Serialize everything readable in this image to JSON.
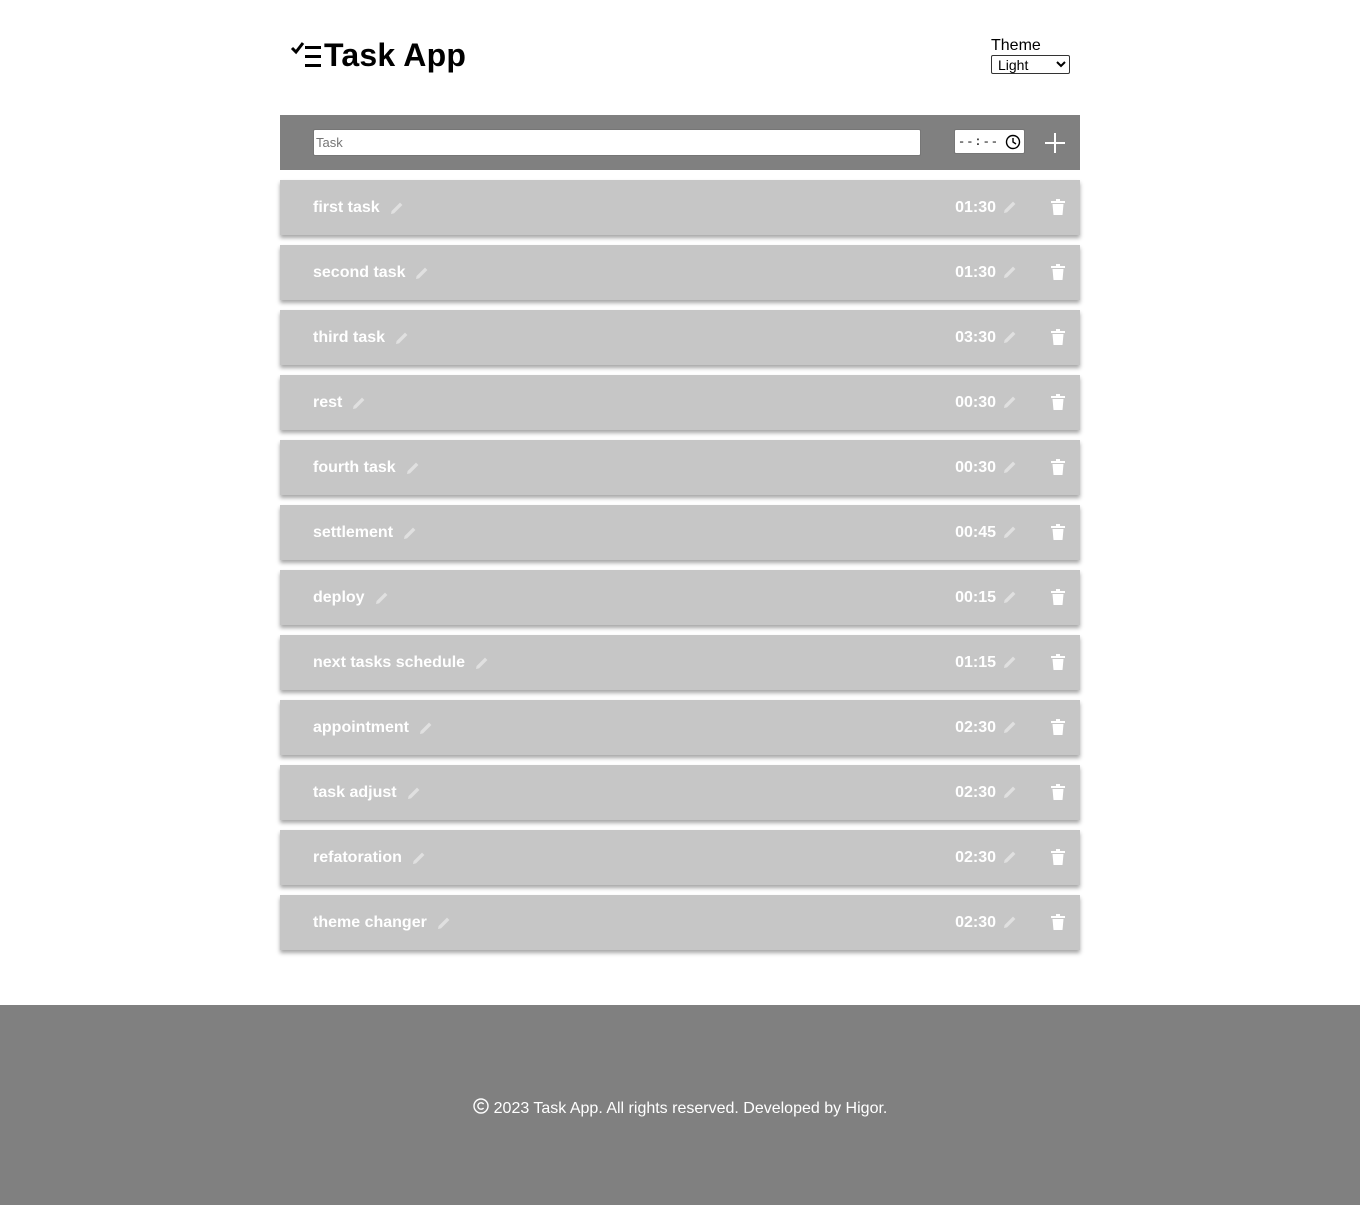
{
  "header": {
    "app_title": "Task App",
    "theme_label": "Theme",
    "theme_selected": "Light",
    "theme_options": [
      "Light"
    ]
  },
  "add_bar": {
    "task_placeholder": "Task",
    "time_placeholder": "--:--"
  },
  "tasks": [
    {
      "name": "first task",
      "time": "01:30"
    },
    {
      "name": "second task",
      "time": "01:30"
    },
    {
      "name": "third task",
      "time": "03:30"
    },
    {
      "name": "rest",
      "time": "00:30"
    },
    {
      "name": "fourth task",
      "time": "00:30"
    },
    {
      "name": "settlement",
      "time": "00:45"
    },
    {
      "name": "deploy",
      "time": "00:15"
    },
    {
      "name": "next tasks schedule",
      "time": "01:15"
    },
    {
      "name": "appointment",
      "time": "02:30"
    },
    {
      "name": "task adjust",
      "time": "02:30"
    },
    {
      "name": "refatoration",
      "time": "02:30"
    },
    {
      "name": "theme changer",
      "time": "02:30"
    }
  ],
  "footer": {
    "text": "2023 Task App. All rights reserved. Developed by Higor."
  },
  "colors": {
    "bar_gray": "#808080",
    "task_bg": "#c6c6c6",
    "task_text": "#ffffff"
  },
  "icons": {
    "logo": "checklist-icon",
    "clock": "clock-icon",
    "add": "plus-icon",
    "edit": "pencil-icon",
    "delete": "trash-icon",
    "copyright": "copyright-icon"
  }
}
